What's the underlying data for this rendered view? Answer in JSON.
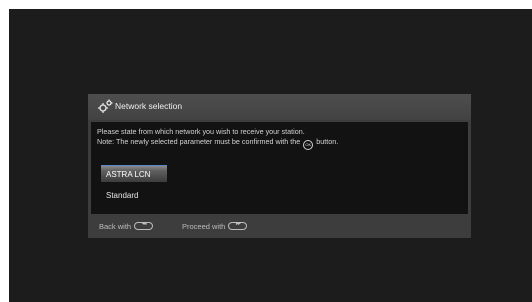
{
  "dialog": {
    "title": "Network selection",
    "instruction_line1": "Please state from which network you wish to receive your station.",
    "instruction_line2_prefix": "Note: The newly selected parameter must be confirmed with the",
    "ok_icon_glyph": "OK",
    "instruction_line2_suffix": "button.",
    "options": [
      {
        "label": "ASTRA LCN",
        "selected": true
      },
      {
        "label": "Standard",
        "selected": false
      }
    ],
    "footer": {
      "back_label": "Back with",
      "back_glyph": "◂◂",
      "proceed_label": "Proceed with",
      "proceed_glyph": "▸▸"
    }
  },
  "colors": {
    "screen_bg": "#1c1c1c",
    "dialog_bg": "#3d3d3d",
    "body_bg": "#121212",
    "selection_accent": "#5a88d0"
  },
  "icons": {
    "header": "gear-icon",
    "ok": "ok-button-icon",
    "back": "rewind-button-icon",
    "proceed": "fast-forward-button-icon"
  }
}
